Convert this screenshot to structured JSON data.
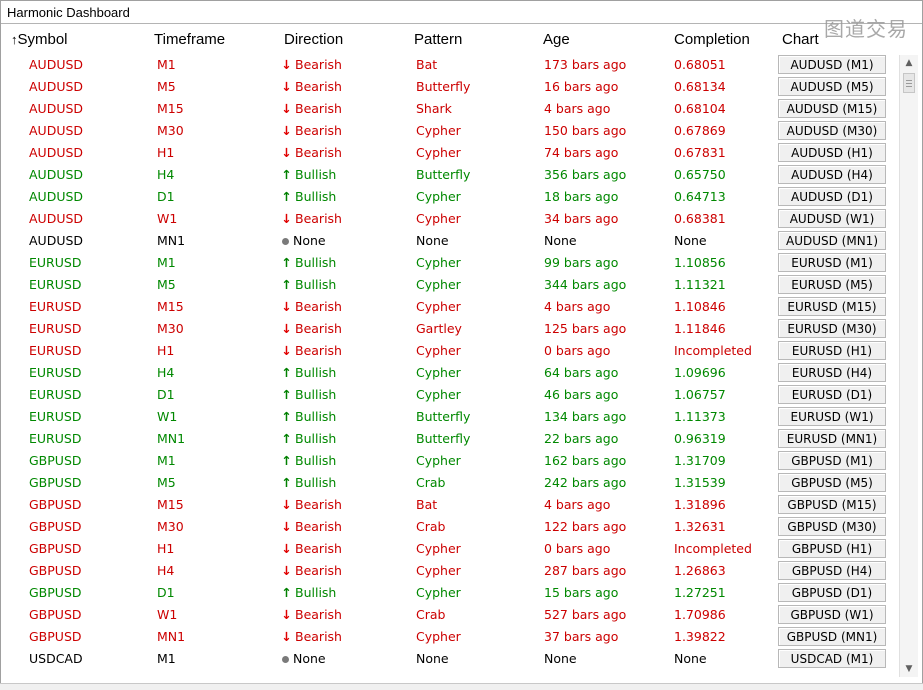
{
  "window": {
    "title": "Harmonic Dashboard",
    "watermark": "图道交易"
  },
  "columns": {
    "sort_indicator": "↑",
    "symbol": "Symbol",
    "timeframe": "Timeframe",
    "direction": "Direction",
    "pattern": "Pattern",
    "age": "Age",
    "completion": "Completion",
    "chart": "Chart"
  },
  "colors": {
    "bearish": "#cc0000",
    "bullish": "#008800",
    "none": "#000000"
  },
  "icons": {
    "bearish": "arrow-down-icon",
    "bullish": "arrow-up-icon",
    "none": "dot-icon"
  },
  "rows": [
    {
      "symbol": "AUDUSD",
      "tf": "M1",
      "direction": "Bearish",
      "pattern": "Bat",
      "age": "173 bars ago",
      "completion": "0.68051",
      "chart": "AUDUSD (M1)"
    },
    {
      "symbol": "AUDUSD",
      "tf": "M5",
      "direction": "Bearish",
      "pattern": "Butterfly",
      "age": "16 bars ago",
      "completion": "0.68134",
      "chart": "AUDUSD (M5)"
    },
    {
      "symbol": "AUDUSD",
      "tf": "M15",
      "direction": "Bearish",
      "pattern": "Shark",
      "age": "4 bars ago",
      "completion": "0.68104",
      "chart": "AUDUSD (M15)"
    },
    {
      "symbol": "AUDUSD",
      "tf": "M30",
      "direction": "Bearish",
      "pattern": "Cypher",
      "age": "150 bars ago",
      "completion": "0.67869",
      "chart": "AUDUSD (M30)"
    },
    {
      "symbol": "AUDUSD",
      "tf": "H1",
      "direction": "Bearish",
      "pattern": "Cypher",
      "age": "74 bars ago",
      "completion": "0.67831",
      "chart": "AUDUSD (H1)"
    },
    {
      "symbol": "AUDUSD",
      "tf": "H4",
      "direction": "Bullish",
      "pattern": "Butterfly",
      "age": "356 bars ago",
      "completion": "0.65750",
      "chart": "AUDUSD (H4)"
    },
    {
      "symbol": "AUDUSD",
      "tf": "D1",
      "direction": "Bullish",
      "pattern": "Cypher",
      "age": "18 bars ago",
      "completion": "0.64713",
      "chart": "AUDUSD (D1)"
    },
    {
      "symbol": "AUDUSD",
      "tf": "W1",
      "direction": "Bearish",
      "pattern": "Cypher",
      "age": "34 bars ago",
      "completion": "0.68381",
      "chart": "AUDUSD (W1)"
    },
    {
      "symbol": "AUDUSD",
      "tf": "MN1",
      "direction": "None",
      "pattern": "None",
      "age": "None",
      "completion": "None",
      "chart": "AUDUSD (MN1)"
    },
    {
      "symbol": "EURUSD",
      "tf": "M1",
      "direction": "Bullish",
      "pattern": "Cypher",
      "age": "99 bars ago",
      "completion": "1.10856",
      "chart": "EURUSD (M1)"
    },
    {
      "symbol": "EURUSD",
      "tf": "M5",
      "direction": "Bullish",
      "pattern": "Cypher",
      "age": "344 bars ago",
      "completion": "1.11321",
      "chart": "EURUSD (M5)"
    },
    {
      "symbol": "EURUSD",
      "tf": "M15",
      "direction": "Bearish",
      "pattern": "Cypher",
      "age": "4 bars ago",
      "completion": "1.10846",
      "chart": "EURUSD (M15)"
    },
    {
      "symbol": "EURUSD",
      "tf": "M30",
      "direction": "Bearish",
      "pattern": "Gartley",
      "age": "125 bars ago",
      "completion": "1.11846",
      "chart": "EURUSD (M30)"
    },
    {
      "symbol": "EURUSD",
      "tf": "H1",
      "direction": "Bearish",
      "pattern": "Cypher",
      "age": "0 bars ago",
      "completion": "Incompleted",
      "chart": "EURUSD (H1)"
    },
    {
      "symbol": "EURUSD",
      "tf": "H4",
      "direction": "Bullish",
      "pattern": "Cypher",
      "age": "64 bars ago",
      "completion": "1.09696",
      "chart": "EURUSD (H4)"
    },
    {
      "symbol": "EURUSD",
      "tf": "D1",
      "direction": "Bullish",
      "pattern": "Cypher",
      "age": "46 bars ago",
      "completion": "1.06757",
      "chart": "EURUSD (D1)"
    },
    {
      "symbol": "EURUSD",
      "tf": "W1",
      "direction": "Bullish",
      "pattern": "Butterfly",
      "age": "134 bars ago",
      "completion": "1.11373",
      "chart": "EURUSD (W1)"
    },
    {
      "symbol": "EURUSD",
      "tf": "MN1",
      "direction": "Bullish",
      "pattern": "Butterfly",
      "age": "22 bars ago",
      "completion": "0.96319",
      "chart": "EURUSD (MN1)"
    },
    {
      "symbol": "GBPUSD",
      "tf": "M1",
      "direction": "Bullish",
      "pattern": "Cypher",
      "age": "162 bars ago",
      "completion": "1.31709",
      "chart": "GBPUSD (M1)"
    },
    {
      "symbol": "GBPUSD",
      "tf": "M5",
      "direction": "Bullish",
      "pattern": "Crab",
      "age": "242 bars ago",
      "completion": "1.31539",
      "chart": "GBPUSD (M5)"
    },
    {
      "symbol": "GBPUSD",
      "tf": "M15",
      "direction": "Bearish",
      "pattern": "Bat",
      "age": "4 bars ago",
      "completion": "1.31896",
      "chart": "GBPUSD (M15)"
    },
    {
      "symbol": "GBPUSD",
      "tf": "M30",
      "direction": "Bearish",
      "pattern": "Crab",
      "age": "122 bars ago",
      "completion": "1.32631",
      "chart": "GBPUSD (M30)"
    },
    {
      "symbol": "GBPUSD",
      "tf": "H1",
      "direction": "Bearish",
      "pattern": "Cypher",
      "age": "0 bars ago",
      "completion": "Incompleted",
      "chart": "GBPUSD (H1)"
    },
    {
      "symbol": "GBPUSD",
      "tf": "H4",
      "direction": "Bearish",
      "pattern": "Cypher",
      "age": "287 bars ago",
      "completion": "1.26863",
      "chart": "GBPUSD (H4)"
    },
    {
      "symbol": "GBPUSD",
      "tf": "D1",
      "direction": "Bullish",
      "pattern": "Cypher",
      "age": "15 bars ago",
      "completion": "1.27251",
      "chart": "GBPUSD (D1)"
    },
    {
      "symbol": "GBPUSD",
      "tf": "W1",
      "direction": "Bearish",
      "pattern": "Crab",
      "age": "527 bars ago",
      "completion": "1.70986",
      "chart": "GBPUSD (W1)"
    },
    {
      "symbol": "GBPUSD",
      "tf": "MN1",
      "direction": "Bearish",
      "pattern": "Cypher",
      "age": "37 bars ago",
      "completion": "1.39822",
      "chart": "GBPUSD (MN1)"
    },
    {
      "symbol": "USDCAD",
      "tf": "M1",
      "direction": "None",
      "pattern": "None",
      "age": "None",
      "completion": "None",
      "chart": "USDCAD (M1)"
    }
  ]
}
